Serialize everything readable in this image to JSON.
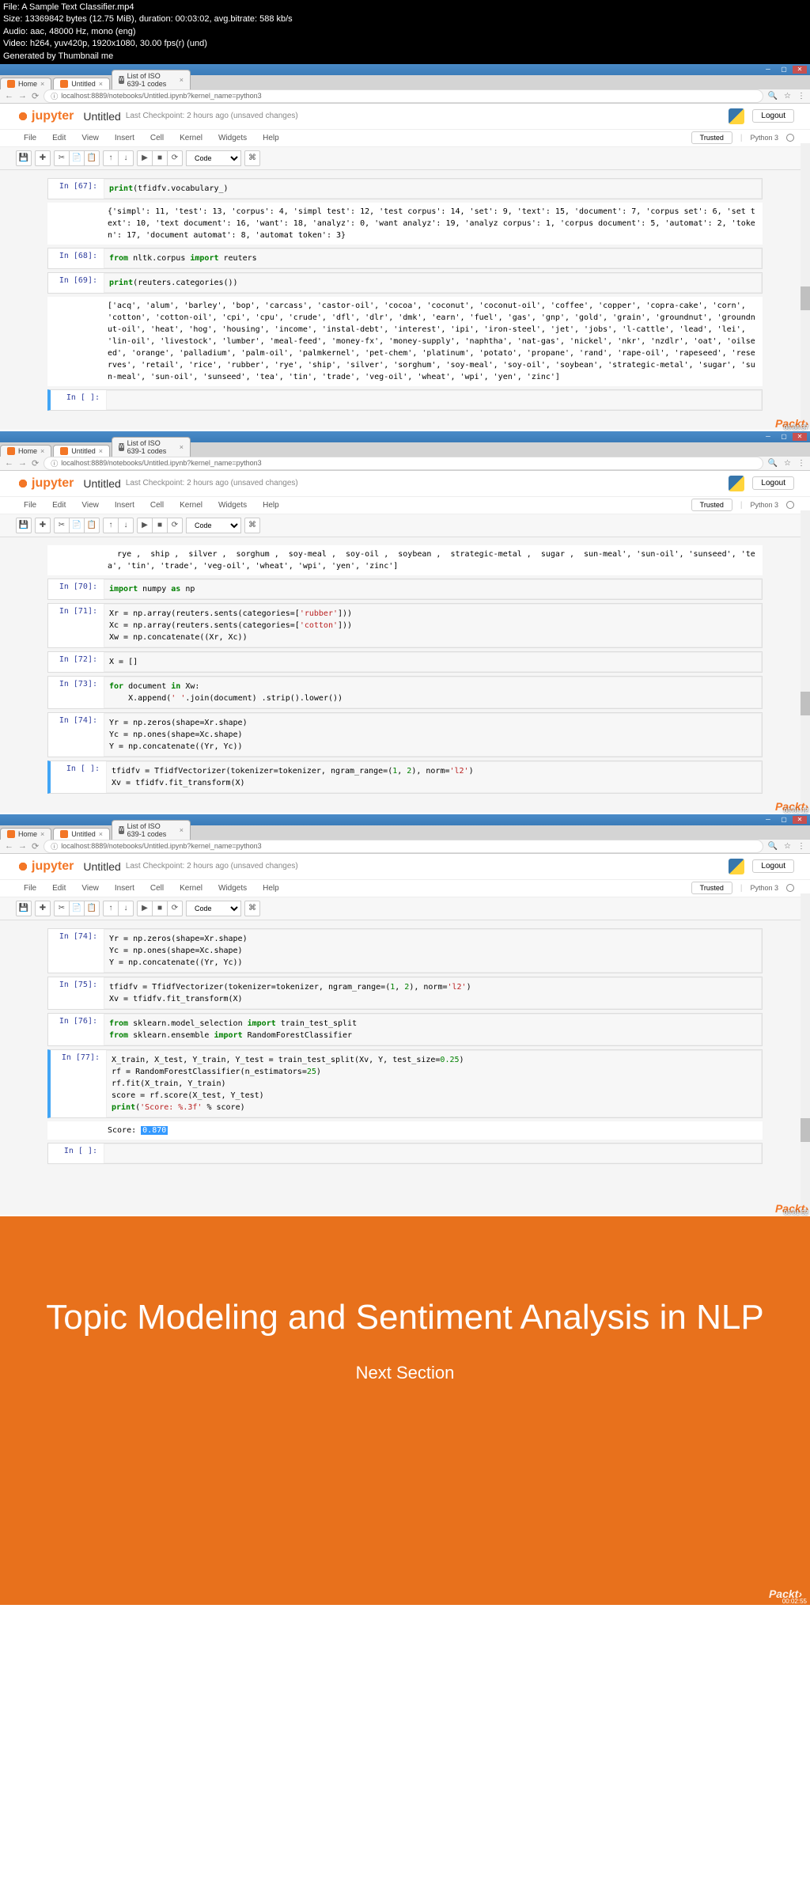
{
  "video_meta": {
    "file": "File: A Sample Text Classifier.mp4",
    "size": "Size: 13369842 bytes (12.75 MiB), duration: 00:03:02, avg.bitrate: 588 kb/s",
    "audio": "Audio: aac, 48000 Hz, mono (eng)",
    "video": "Video: h264, yuv420p, 1920x1080, 30.00 fps(r) (und)",
    "gen": "Generated by Thumbnail me"
  },
  "browser": {
    "tabs": {
      "home": "Home",
      "untitled": "Untitled",
      "wiki": "List of ISO 639-1 codes"
    },
    "url": "localhost:8889/notebooks/Untitled.ipynb?kernel_name=python3"
  },
  "jupyter": {
    "logo": "jupyter",
    "title": "Untitled",
    "checkpoint": "Last Checkpoint: 2 hours ago (unsaved changes)",
    "logout": "Logout",
    "menu": {
      "file": "File",
      "edit": "Edit",
      "view": "View",
      "insert": "Insert",
      "cell": "Cell",
      "kernel": "Kernel",
      "widgets": "Widgets",
      "help": "Help"
    },
    "trusted": "Trusted",
    "kernel": "Python 3",
    "celltype": "Code"
  },
  "frame1": {
    "ts": "00:00:37",
    "cells": {
      "p67": "In [67]:",
      "c67": "print(tfidfv.vocabulary_)",
      "o67": "{'simpl': 11, 'test': 13, 'corpus': 4, 'simpl test': 12, 'test corpus': 14, 'set': 9, 'text': 15, 'document': 7, 'corpus set': 6, 'set text': 10, 'text document': 16, 'want': 18, 'analyz': 0, 'want analyz': 19, 'analyz corpus': 1, 'corpus document': 5, 'automat': 2, 'token': 17, 'document automat': 8, 'automat token': 3}",
      "p68": "In [68]:",
      "c68_a": "from",
      "c68_b": " nltk.corpus ",
      "c68_c": "import",
      "c68_d": " reuters",
      "p69": "In [69]:",
      "c69_a": "print",
      "c69_b": "(reuters.categories())",
      "o69": "['acq', 'alum', 'barley', 'bop', 'carcass', 'castor-oil', 'cocoa', 'coconut', 'coconut-oil', 'coffee', 'copper', 'copra-cake', 'corn', 'cotton', 'cotton-oil', 'cpi', 'cpu', 'crude', 'dfl', 'dlr', 'dmk', 'earn', 'fuel', 'gas', 'gnp', 'gold', 'grain', 'groundnut', 'groundnut-oil', 'heat', 'hog', 'housing', 'income', 'instal-debt', 'interest', 'ipi', 'iron-steel', 'jet', 'jobs', 'l-cattle', 'lead', 'lei', 'lin-oil', 'livestock', 'lumber', 'meal-feed', 'money-fx', 'money-supply', 'naphtha', 'nat-gas', 'nickel', 'nkr', 'nzdlr', 'oat', 'oilseed', 'orange', 'palladium', 'palm-oil', 'palmkernel', 'pet-chem', 'platinum', 'potato', 'propane', 'rand', 'rape-oil', 'rapeseed', 'reserves', 'retail', 'rice', 'rubber', 'rye', 'ship', 'silver', 'sorghum', 'soy-meal', 'soy-oil', 'soybean', 'strategic-metal', 'sugar', 'sun-meal', 'sun-oil', 'sunseed', 'tea', 'tin', 'trade', 'veg-oil', 'wheat', 'wpi', 'yen', 'zinc']",
      "pempty": "In [ ]:"
    }
  },
  "frame2": {
    "ts": "00:01:12",
    "cells": {
      "otop": "  rye ,  ship ,  silver ,  sorghum ,  soy-meal ,  soy-oil ,  soybean ,  strategic-metal ,  sugar ,  sun-meal', 'sun-oil', 'sunseed', 'tea', 'tin', 'trade', 'veg-oil', 'wheat', 'wpi', 'yen', 'zinc']",
      "p70": "In [70]:",
      "c70": "import numpy as np",
      "p71": "In [71]:",
      "c71": "Xr = np.array(reuters.sents(categories=['rubber']))\nXc = np.array(reuters.sents(categories=['cotton']))\nXw = np.concatenate((Xr, Xc))",
      "p72": "In [72]:",
      "c72": "X = []",
      "p73": "In [73]:",
      "c73": "for document in Xw:\n    X.append(' '.join(document) .strip().lower())",
      "p74": "In [74]:",
      "c74": "Yr = np.zeros(shape=Xr.shape)\nYc = np.ones(shape=Xc.shape)\nY = np.concatenate((Yr, Yc))",
      "pempty": "In [ ]:",
      "clast": "tfidfv = TfidfVectorizer(tokenizer=tokenizer, ngram_range=(1, 2), norm='l2')\nXv = tfidfv.fit_transform(X)"
    }
  },
  "frame3": {
    "ts": "00:01:52",
    "cells": {
      "p74": "In [74]:",
      "c74": "Yr = np.zeros(shape=Xr.shape)\nYc = np.ones(shape=Xc.shape)\nY = np.concatenate((Yr, Yc))",
      "p75": "In [75]:",
      "c75": "tfidfv = TfidfVectorizer(tokenizer=tokenizer, ngram_range=(1, 2), norm='l2')\nXv = tfidfv.fit_transform(X)",
      "p76": "In [76]:",
      "c76": "from sklearn.model_selection import train_test_split\nfrom sklearn.ensemble import RandomForestClassifier",
      "p77": "In [77]:",
      "c77": "X_train, X_test, Y_train, Y_test = train_test_split(Xv, Y, test_size=0.25)\nrf = RandomForestClassifier(n_estimators=25)\nrf.fit(X_train, Y_train)\nscore = rf.score(X_test, Y_test)\nprint('Score: %.3f' % score)",
      "o77a": "Score: ",
      "o77b": "0.870",
      "pempty": "In [ ]:"
    }
  },
  "slide": {
    "title": "Topic Modeling and Sentiment Analysis in NLP",
    "sub": "Next Section",
    "ts": "00:02:55",
    "brand": "Packt›"
  },
  "brand": "Packt›"
}
